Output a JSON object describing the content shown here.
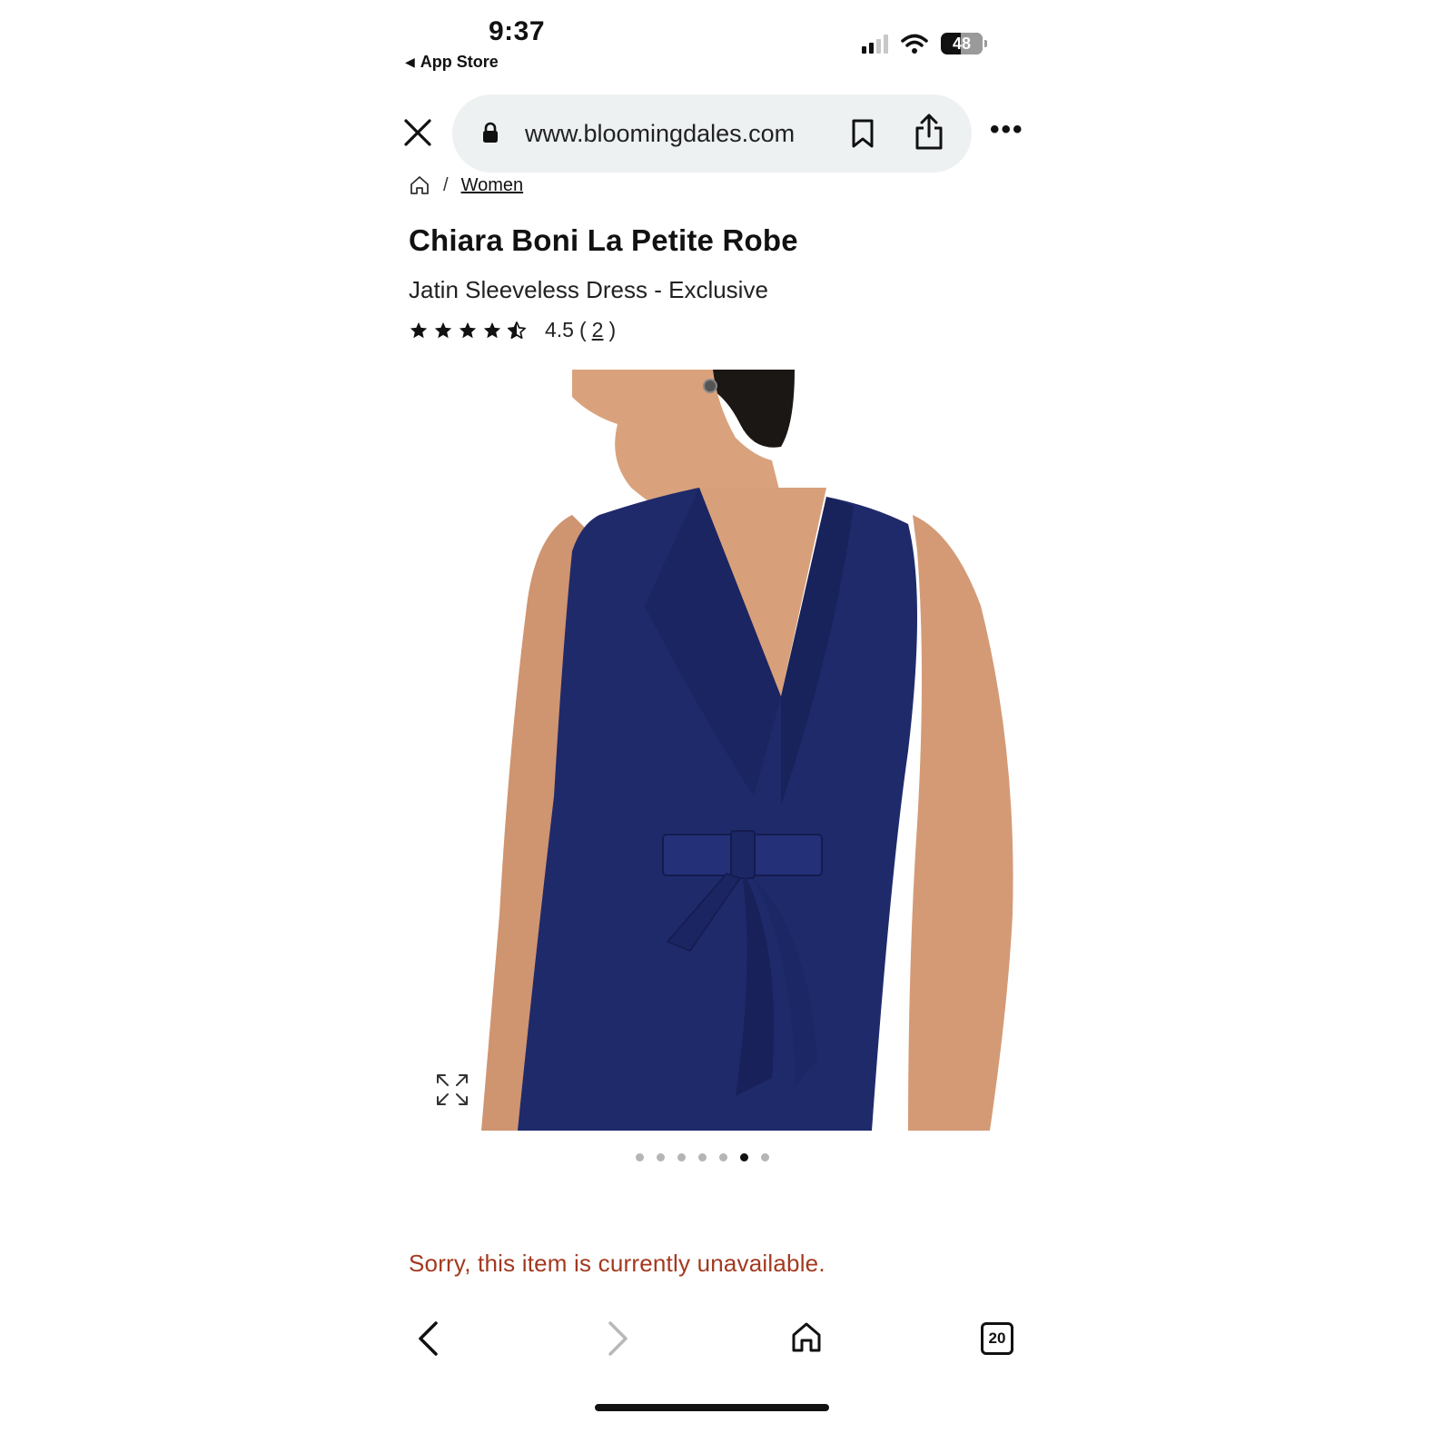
{
  "status_bar": {
    "time": "9:37",
    "back_app": "App Store",
    "battery": "48"
  },
  "browser": {
    "url": "www.bloomingdales.com",
    "tab_count": "20"
  },
  "breadcrumb": {
    "separator": "/",
    "link": "Women"
  },
  "product": {
    "brand": "Chiara Boni La Petite Robe",
    "name": "Jatin Sleeveless Dress - Exclusive",
    "rating": "4.5",
    "review_count": "2",
    "image_count": 7,
    "active_image": 6,
    "unavailable_message": "Sorry, this item is currently unavailable."
  },
  "colors": {
    "dress": "#1f2a6b",
    "error": "#a3391f",
    "urlbar": "#edf1f2"
  }
}
